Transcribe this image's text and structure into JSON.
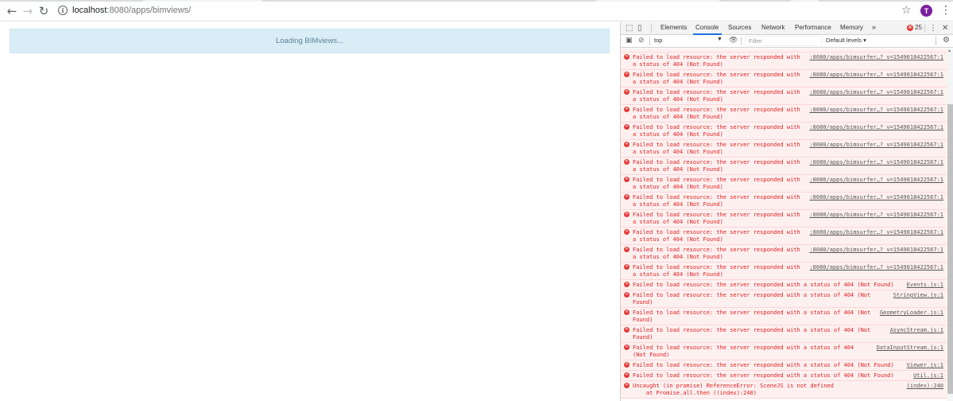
{
  "browser": {
    "url_host": "localhost",
    "url_path": ":8080/apps/bimviews/",
    "avatar_letter": "T",
    "accent": "#7b1fa2"
  },
  "page": {
    "loading_text": "Loading BIMviews...",
    "loading_bg": "#d9edf7"
  },
  "devtools": {
    "tabs": [
      "Elements",
      "Console",
      "Sources",
      "Network",
      "Performance",
      "Memory"
    ],
    "more_tabs": "»",
    "error_count": "25",
    "context": "top",
    "filter_placeholder": "Filter",
    "levels_label": "Default levels ▾",
    "messages": [
      {
        "icon": "error",
        "line1": "Failed to load resource: the server responded with",
        "src": ":8080/apps/bimsurfer…? v=1549018422567:1",
        "line2": "a status of 404 (Not Found)"
      },
      {
        "icon": "error",
        "line1": "Failed to load resource: the server responded with",
        "src": ":8080/apps/bimsurfer…? v=1549018422567:1",
        "line2": "a status of 404 (Not Found)"
      },
      {
        "icon": "error",
        "line1": "Failed to load resource: the server responded with",
        "src": ":8080/apps/bimsurfer…? v=1549018422567:1",
        "line2": "a status of 404 (Not Found)"
      },
      {
        "icon": "error",
        "line1": "Failed to load resource: the server responded with",
        "src": ":8080/apps/bimsurfer…? v=1549018422567:1",
        "line2": "a status of 404 (Not Found)"
      },
      {
        "icon": "error",
        "line1": "Failed to load resource: the server responded with",
        "src": ":8080/apps/bimsurfer…? v=1549018422567:1",
        "line2": "a status of 404 (Not Found)"
      },
      {
        "icon": "error",
        "line1": "Failed to load resource: the server responded with",
        "src": ":8080/apps/bimsurfer…? v=1549018422567:1",
        "line2": "a status of 404 (Not Found)"
      },
      {
        "icon": "error",
        "line1": "Failed to load resource: the server responded with",
        "src": ":8080/apps/bimsurfer…? v=1549018422567:1",
        "line2": "a status of 404 (Not Found)"
      },
      {
        "icon": "error",
        "line1": "Failed to load resource: the server responded with",
        "src": ":8080/apps/bimsurfer…? v=1549018422567:1",
        "line2": "a status of 404 (Not Found)"
      },
      {
        "icon": "error",
        "line1": "Failed to load resource: the server responded with",
        "src": ":8080/apps/bimsurfer…? v=1549018422567:1",
        "line2": "a status of 404 (Not Found)"
      },
      {
        "icon": "error",
        "line1": "Failed to load resource: the server responded with",
        "src": ":8080/apps/bimsurfer…? v=1549018422567:1",
        "line2": "a status of 404 (Not Found)"
      },
      {
        "icon": "error",
        "line1": "Failed to load resource: the server responded with",
        "src": ":8080/apps/bimsurfer…? v=1549018422567:1",
        "line2": "a status of 404 (Not Found)"
      },
      {
        "icon": "error",
        "line1": "Failed to load resource: the server responded with",
        "src": ":8080/apps/bimsurfer…? v=1549018422567:1",
        "line2": "a status of 404 (Not Found)"
      },
      {
        "icon": "error",
        "line1": "Failed to load resource: the server responded with",
        "src": ":8080/apps/bimsurfer…? v=1549018422567:1",
        "line2": "a status of 404 (Not Found)"
      },
      {
        "icon": "error",
        "line1": "Failed to load resource: the server responded with a status of 404 (Not Found)",
        "src": "Events.js:1",
        "line2": ""
      },
      {
        "icon": "error",
        "line1": "Failed to load resource: the server responded with a status of 404 (Not",
        "src": "StringView.js:1",
        "line2": "Found)"
      },
      {
        "icon": "error",
        "line1": "Failed to load resource: the server responded with a status of 404 (Not",
        "src": "GeometryLoader.js:1",
        "line2": "Found)"
      },
      {
        "icon": "error",
        "line1": "Failed to load resource: the server responded with a status of 404 (Not",
        "src": "AsyncStream.js:1",
        "line2": "Found)"
      },
      {
        "icon": "error",
        "line1": "Failed to load resource: the server responded with a status of 404",
        "src": "DataInputStream.js:1",
        "line2": "(Not Found)"
      },
      {
        "icon": "error",
        "line1": "Failed to load resource: the server responded with a status of 404 (Not Found)",
        "src": "Viewer.js:1",
        "line2": ""
      },
      {
        "icon": "error",
        "line1": "Failed to load resource: the server responded with a status of 404 (Not Found)",
        "src": "Util.js:1",
        "line2": ""
      },
      {
        "icon": "error",
        "line1": "Uncaught (in promise) ReferenceError: SceneJS is not defined",
        "src": "(index):240",
        "line2": "    at Promise.all.then ((index):240)"
      }
    ],
    "prompt": "›"
  }
}
